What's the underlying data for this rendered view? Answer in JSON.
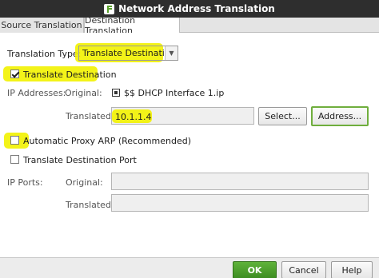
{
  "window": {
    "title": "Network Address Translation"
  },
  "tabs": [
    {
      "label": "Source Translation",
      "active": false
    },
    {
      "label": "Destination Translation",
      "active": true
    }
  ],
  "translation_type": {
    "label": "Translation Type:",
    "value": "Translate Destination"
  },
  "translate_destination": {
    "label": "Translate Destination",
    "checked": true
  },
  "ip_addresses": {
    "label": "IP Addresses:",
    "original_label": "Original:",
    "original_value": "$$ DHCP Interface 1.ip",
    "translated_label": "Translated:",
    "translated_value": "10.1.1.4",
    "select_button": "Select...",
    "address_button": "Address..."
  },
  "auto_proxy_arp": {
    "label": "Automatic Proxy ARP (Recommended)",
    "checked": false
  },
  "translate_port": {
    "label": "Translate Destination Port",
    "checked": false
  },
  "ip_ports": {
    "label": "IP Ports:",
    "original_label": "Original:",
    "original_value": "",
    "translated_label": "Translated:",
    "translated_value": ""
  },
  "footer": {
    "ok": "OK",
    "cancel": "Cancel",
    "help": "Help"
  },
  "colors": {
    "highlight": "#f2f200",
    "titlebar": "#2e2e2e",
    "ok_button": "#4ea02e",
    "focus_border": "#6fae3d"
  }
}
